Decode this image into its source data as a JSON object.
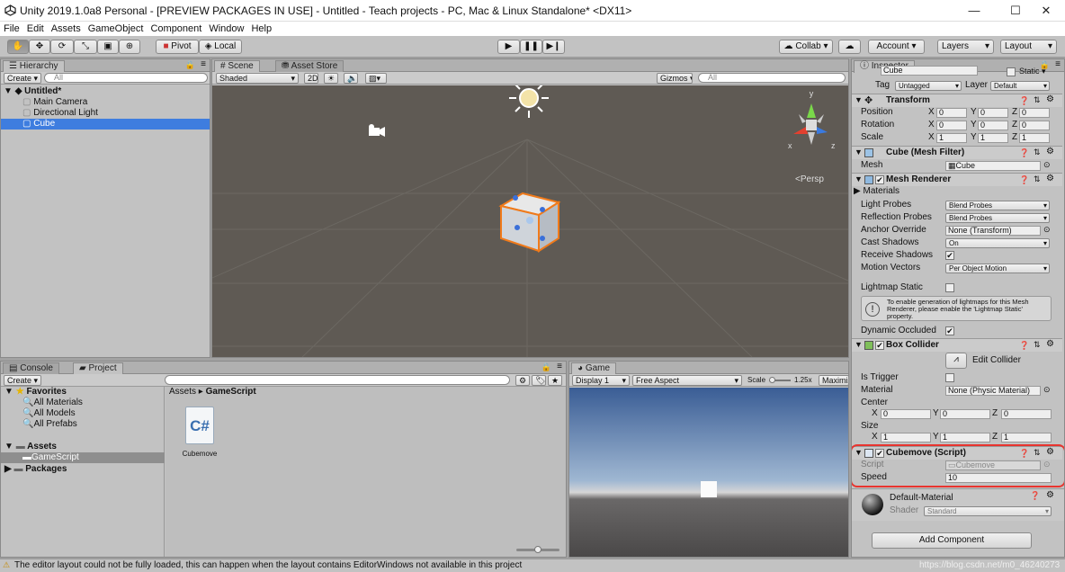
{
  "window": {
    "title": "Unity 2019.1.0a8 Personal - [PREVIEW PACKAGES IN USE] - Untitled - Teach projects - PC, Mac & Linux Standalone* <DX11>",
    "minimize": "—",
    "maximize": "☐",
    "close": "✕"
  },
  "menu": [
    "File",
    "Edit",
    "Assets",
    "GameObject",
    "Component",
    "Window",
    "Help"
  ],
  "toolbar": {
    "pivot": "Pivot",
    "local": "Local",
    "collab": "Collab ▾",
    "account": "Account ▾",
    "layers": "Layers",
    "layout": "Layout"
  },
  "hierarchy": {
    "tab": "Hierarchy",
    "create": "Create ▾",
    "search_placeholder": "All",
    "scene": "Untitled*",
    "items": [
      "Main Camera",
      "Directional Light",
      "Cube"
    ]
  },
  "scene": {
    "tab_scene": "Scene",
    "tab_asset_store": "Asset Store",
    "shading": "Shaded",
    "mode_2d": "2D",
    "gizmos": "Gizmos ▾",
    "search_placeholder": "All",
    "persp": "<Persp",
    "axis_x": "x",
    "axis_y": "y",
    "axis_z": "z"
  },
  "project": {
    "tab_console": "Console",
    "tab_project": "Project",
    "create": "Create ▾",
    "favorites": "Favorites",
    "fav_items": [
      "All Materials",
      "All Models",
      "All Prefabs"
    ],
    "assets": "Assets",
    "assets_children": [
      "GameScript"
    ],
    "packages": "Packages",
    "breadcrumb_root": "Assets",
    "breadcrumb_sep": "▸",
    "breadcrumb_current": "GameScript",
    "file_name": "Cubemove",
    "file_icon_text": "C#"
  },
  "game": {
    "tab": "Game",
    "display": "Display 1",
    "aspect": "Free Aspect",
    "scale_label": "Scale",
    "scale_value": "1.25x",
    "maximize": "Maximize"
  },
  "inspector": {
    "tab": "Inspector",
    "object_name": "Cube",
    "static": "Static ▾",
    "tag_label": "Tag",
    "tag_value": "Untagged",
    "layer_label": "Layer",
    "layer_value": "Default",
    "transform": {
      "title": "Transform",
      "position_label": "Position",
      "rotation_label": "Rotation",
      "scale_label": "Scale",
      "position": [
        "0",
        "0",
        "0"
      ],
      "rotation": [
        "0",
        "0",
        "0"
      ],
      "scale": [
        "1",
        "1",
        "1"
      ]
    },
    "mesh_filter": {
      "title": "Cube (Mesh Filter)",
      "mesh_label": "Mesh",
      "mesh_value": "Cube"
    },
    "mesh_renderer": {
      "title": "Mesh Renderer",
      "materials": "Materials",
      "light_probes_label": "Light Probes",
      "light_probes_value": "Blend Probes",
      "reflection_probes_label": "Reflection Probes",
      "reflection_probes_value": "Blend Probes",
      "anchor_override_label": "Anchor Override",
      "anchor_override_value": "None (Transform)",
      "cast_shadows_label": "Cast Shadows",
      "cast_shadows_value": "On",
      "receive_shadows_label": "Receive Shadows",
      "motion_vectors_label": "Motion Vectors",
      "motion_vectors_value": "Per Object Motion",
      "lightmap_static_label": "Lightmap Static",
      "lightmap_info": "To enable generation of lightmaps for this Mesh Renderer, please enable the 'Lightmap Static' property.",
      "dynamic_occluded_label": "Dynamic Occluded"
    },
    "box_collider": {
      "title": "Box Collider",
      "edit_collider": "Edit Collider",
      "is_trigger_label": "Is Trigger",
      "material_label": "Material",
      "material_value": "None (Physic Material)",
      "center_label": "Center",
      "size_label": "Size",
      "center": [
        "0",
        "0",
        "0"
      ],
      "size": [
        "1",
        "1",
        "1"
      ]
    },
    "script": {
      "title": "Cubemove (Script)",
      "script_label": "Script",
      "script_value": "Cubemove",
      "speed_label": "Speed",
      "speed_value": "10"
    },
    "material": {
      "name": "Default-Material",
      "shader_label": "Shader",
      "shader_value": "Standard"
    },
    "add_component": "Add Component"
  },
  "status": {
    "message": "The editor layout could not be fully loaded, this can happen when the layout contains EditorWindows not available in this project",
    "watermark": "https://blog.csdn.net/m0_46240273"
  },
  "colors": {
    "selection": "#3e7ddf",
    "highlight_outline": "#e8342f",
    "selected_object_outline": "#f07a1a",
    "scene_bg": "#5f5a54",
    "game_sky_top": "#3a5d95",
    "game_ground": "#4a4848"
  }
}
